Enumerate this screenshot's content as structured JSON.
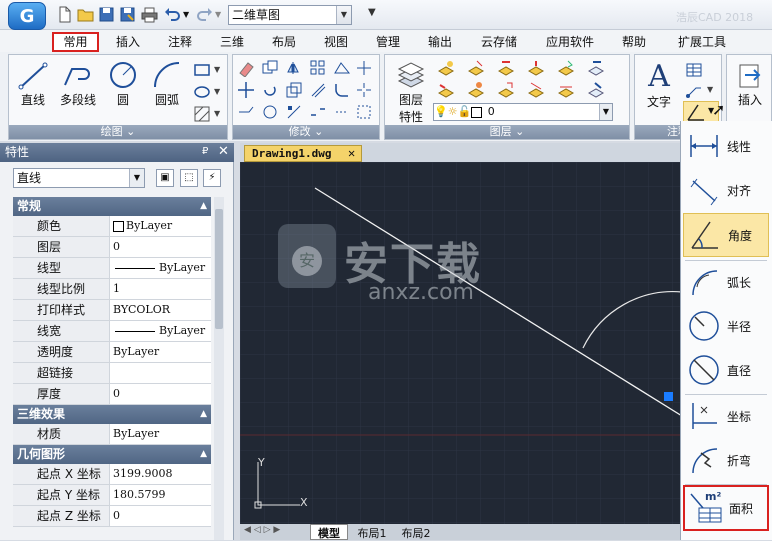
{
  "quick_access": {
    "workspace": "二维草图",
    "app_title": "浩辰CAD 2018"
  },
  "menu": {
    "tabs": [
      "常用",
      "插入",
      "注释",
      "三维",
      "布局",
      "视图",
      "管理",
      "输出",
      "云存储",
      "应用软件",
      "帮助",
      "扩展工具"
    ]
  },
  "ribbon": {
    "draw": {
      "title": "绘图 ⌄",
      "line": "直线",
      "polyline": "多段线",
      "circle": "圆",
      "arc": "圆弧"
    },
    "modify": {
      "title": "修改 ⌄"
    },
    "layers": {
      "title": "图层 ⌄",
      "props_line1": "图层",
      "props_line2": "特性",
      "current_layer": "0"
    },
    "annotation": {
      "title": "注释",
      "text": "文字"
    },
    "insert": {
      "label": "插入"
    }
  },
  "properties": {
    "title": "特性",
    "object_type": "直线",
    "sections": {
      "general": "常规",
      "three_d": "三维效果",
      "geometry": "几何图形"
    },
    "general_rows": [
      {
        "key": "颜色",
        "value": "ByLayer"
      },
      {
        "key": "图层",
        "value": "0"
      },
      {
        "key": "线型",
        "value": "ByLayer"
      },
      {
        "key": "线型比例",
        "value": "1"
      },
      {
        "key": "打印样式",
        "value": "BYCOLOR"
      },
      {
        "key": "线宽",
        "value": "ByLayer"
      },
      {
        "key": "透明度",
        "value": "ByLayer"
      },
      {
        "key": "超链接",
        "value": ""
      },
      {
        "key": "厚度",
        "value": "0"
      }
    ],
    "three_d_rows": [
      {
        "key": "材质",
        "value": "ByLayer"
      }
    ],
    "geometry_rows": [
      {
        "key": "起点 X 坐标",
        "value": "3199.9008"
      },
      {
        "key": "起点 Y 坐标",
        "value": "180.5799"
      },
      {
        "key": "起点 Z 坐标",
        "value": "0"
      }
    ]
  },
  "document": {
    "tab": "Drawing1.dwg",
    "layout_tabs": [
      "模型",
      "布局1",
      "布局2"
    ],
    "axis_y": "Y",
    "axis_x": "X",
    "watermark_main": "安下载",
    "watermark_sub": "anxz.com"
  },
  "dim_menu": {
    "items": [
      "线性",
      "对齐",
      "角度",
      "弧长",
      "半径",
      "直径",
      "坐标",
      "折弯",
      "面积"
    ],
    "area_superscript": "m²"
  }
}
